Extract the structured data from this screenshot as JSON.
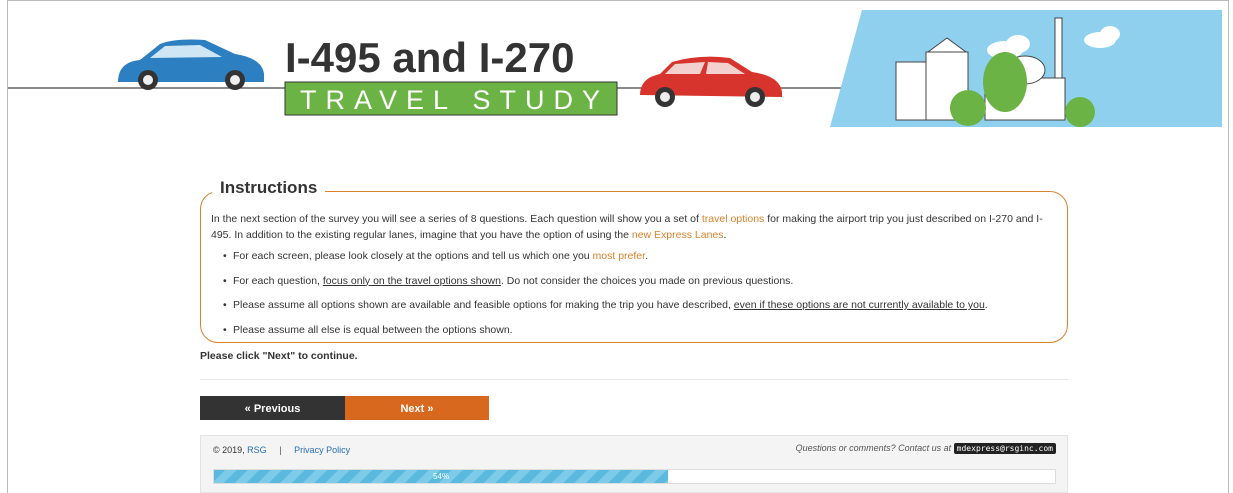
{
  "banner": {
    "title_line1": "I-495 and I-270",
    "title_line2": "TRAVEL STUDY"
  },
  "instructions": {
    "heading": "Instructions",
    "para_part1": "In the next section of the survey you will see a series of 8 questions. Each question will show you a set of ",
    "para_link1": "travel options",
    "para_part2": " for making the airport trip you just described on I-270 and I-495. In addition to the existing regular lanes, imagine that you have the option of using the ",
    "para_link2": "new Express Lanes",
    "para_part3": ".",
    "bullets": {
      "b1_text": "For each screen, please look closely at the options and tell us which one you ",
      "b1_emph": "most prefer",
      "b1_end": ".",
      "b2_text": "For each question, ",
      "b2_emph": "focus only on the travel options shown",
      "b2_end": ". Do not consider the choices you made on previous questions.",
      "b3_text": "Please assume all options shown are available and feasible options for making the trip you have described, ",
      "b3_emph": "even if these options are not currently available to you",
      "b3_end": ".",
      "b4_text": "Please assume all else is equal between the options shown."
    }
  },
  "continue_text": "Please click \"Next\" to continue.",
  "nav": {
    "prev_label": "« Previous",
    "next_label": "Next »"
  },
  "footer": {
    "copyright": "© 2019,",
    "company": "RSG",
    "separator": "|",
    "privacy": "Privacy Policy",
    "contact_text": "Questions or comments? Contact us at",
    "email": "mdexpress@rsginc.com"
  },
  "progress": {
    "label": "54%",
    "percent": 54
  },
  "colors": {
    "accent_orange": "#d9822b",
    "next_button": "#d9681f",
    "prev_button": "#333333",
    "progress_blue": "#5bb9de",
    "banner_green": "#6cb346"
  }
}
